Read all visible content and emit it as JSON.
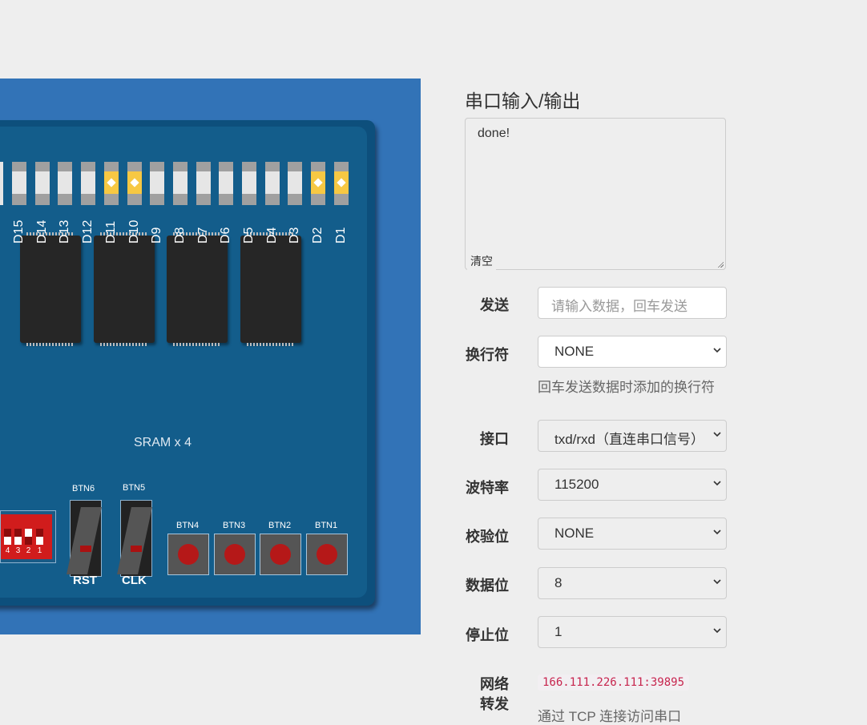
{
  "board": {
    "leds": [
      {
        "label": "D15",
        "on": false
      },
      {
        "label": "D14",
        "on": false
      },
      {
        "label": "D13",
        "on": false
      },
      {
        "label": "D12",
        "on": false
      },
      {
        "label": "D11",
        "on": true
      },
      {
        "label": "D10",
        "on": true
      },
      {
        "label": "D9",
        "on": false
      },
      {
        "label": "D8",
        "on": false
      },
      {
        "label": "D7",
        "on": false
      },
      {
        "label": "D6",
        "on": false
      },
      {
        "label": "D5",
        "on": false
      },
      {
        "label": "D4",
        "on": false
      },
      {
        "label": "D3",
        "on": false
      },
      {
        "label": "D2",
        "on": true
      },
      {
        "label": "D1",
        "on": true
      }
    ],
    "sram_label": "SRAM x 4",
    "dip_numbers": [
      "4",
      "3",
      "2",
      "1"
    ],
    "slide_buttons": [
      {
        "label": "BTN6",
        "caption": "RST"
      },
      {
        "label": "BTN5",
        "caption": "CLK"
      }
    ],
    "push_buttons": [
      "BTN4",
      "BTN3",
      "BTN2",
      "BTN1"
    ]
  },
  "serial": {
    "title": "串口输入/输出",
    "output": "done!",
    "clear_label": "清空"
  },
  "form": {
    "send_label": "发送",
    "send_placeholder": "请输入数据，回车发送",
    "newline_label": "换行符",
    "newline_value": "NONE",
    "newline_hint": "回车发送数据时添加的换行符",
    "interface_label": "接口",
    "interface_value": "txd/rxd（直连串口信号）",
    "baud_label": "波特率",
    "baud_value": "115200",
    "parity_label": "校验位",
    "parity_value": "NONE",
    "databits_label": "数据位",
    "databits_value": "8",
    "stopbits_label": "停止位",
    "stopbits_value": "1",
    "forward_label_1": "网络",
    "forward_label_2": "转发",
    "forward_address": "166.111.226.111:39895",
    "forward_hint": "通过 TCP 连接访问串口"
  }
}
